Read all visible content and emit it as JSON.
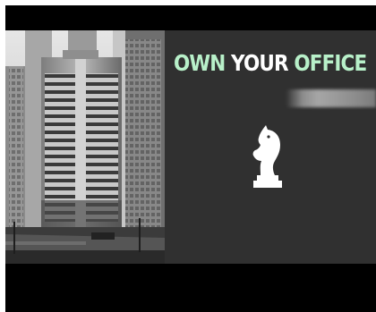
{
  "video": {
    "headline": {
      "word1": "OWN",
      "word2": "YOUR",
      "word3": "OFFICE"
    },
    "icon": "chess-knight-icon",
    "colors": {
      "accent": "#b8f0c9",
      "headline_white": "#ffffff",
      "panel_background": "#303030",
      "letterbox": "#000000"
    }
  }
}
